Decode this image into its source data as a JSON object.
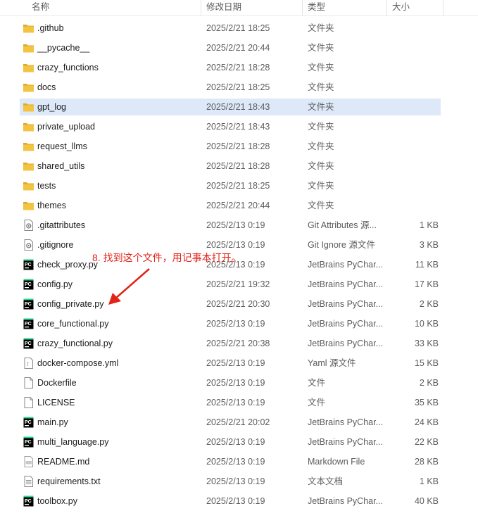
{
  "header": {
    "name": "名称",
    "date": "修改日期",
    "type": "类型",
    "size": "大小"
  },
  "files": [
    {
      "name": ".github",
      "date": "2025/2/21 18:25",
      "type": "文件夹",
      "size": "",
      "icon": "folder-icon"
    },
    {
      "name": "__pycache__",
      "date": "2025/2/21 20:44",
      "type": "文件夹",
      "size": "",
      "icon": "folder-icon"
    },
    {
      "name": "crazy_functions",
      "date": "2025/2/21 18:28",
      "type": "文件夹",
      "size": "",
      "icon": "folder-icon"
    },
    {
      "name": "docs",
      "date": "2025/2/21 18:25",
      "type": "文件夹",
      "size": "",
      "icon": "folder-icon"
    },
    {
      "name": "gpt_log",
      "date": "2025/2/21 18:43",
      "type": "文件夹",
      "size": "",
      "icon": "folder-icon",
      "selected": true
    },
    {
      "name": "private_upload",
      "date": "2025/2/21 18:43",
      "type": "文件夹",
      "size": "",
      "icon": "folder-icon"
    },
    {
      "name": "request_llms",
      "date": "2025/2/21 18:28",
      "type": "文件夹",
      "size": "",
      "icon": "folder-icon"
    },
    {
      "name": "shared_utils",
      "date": "2025/2/21 18:28",
      "type": "文件夹",
      "size": "",
      "icon": "folder-icon"
    },
    {
      "name": "tests",
      "date": "2025/2/21 18:25",
      "type": "文件夹",
      "size": "",
      "icon": "folder-icon"
    },
    {
      "name": "themes",
      "date": "2025/2/21 20:44",
      "type": "文件夹",
      "size": "",
      "icon": "folder-icon"
    },
    {
      "name": ".gitattributes",
      "date": "2025/2/13 0:19",
      "type": "Git Attributes 源...",
      "size": "1 KB",
      "icon": "git-file-icon"
    },
    {
      "name": ".gitignore",
      "date": "2025/2/13 0:19",
      "type": "Git Ignore 源文件",
      "size": "3 KB",
      "icon": "git-file-icon"
    },
    {
      "name": "check_proxy.py",
      "date": "2025/2/13 0:19",
      "type": "JetBrains PyChar...",
      "size": "11 KB",
      "icon": "pycharm-file-icon"
    },
    {
      "name": "config.py",
      "date": "2025/2/21 19:32",
      "type": "JetBrains PyChar...",
      "size": "17 KB",
      "icon": "pycharm-file-icon"
    },
    {
      "name": "config_private.py",
      "date": "2025/2/21 20:30",
      "type": "JetBrains PyChar...",
      "size": "2 KB",
      "icon": "pycharm-file-icon"
    },
    {
      "name": "core_functional.py",
      "date": "2025/2/13 0:19",
      "type": "JetBrains PyChar...",
      "size": "10 KB",
      "icon": "pycharm-file-icon"
    },
    {
      "name": "crazy_functional.py",
      "date": "2025/2/21 20:38",
      "type": "JetBrains PyChar...",
      "size": "33 KB",
      "icon": "pycharm-file-icon"
    },
    {
      "name": "docker-compose.yml",
      "date": "2025/2/13 0:19",
      "type": "Yaml 源文件",
      "size": "15 KB",
      "icon": "yaml-file-icon"
    },
    {
      "name": "Dockerfile",
      "date": "2025/2/13 0:19",
      "type": "文件",
      "size": "2 KB",
      "icon": "blank-file-icon"
    },
    {
      "name": "LICENSE",
      "date": "2025/2/13 0:19",
      "type": "文件",
      "size": "35 KB",
      "icon": "blank-file-icon"
    },
    {
      "name": "main.py",
      "date": "2025/2/21 20:02",
      "type": "JetBrains PyChar...",
      "size": "24 KB",
      "icon": "pycharm-file-icon"
    },
    {
      "name": "multi_language.py",
      "date": "2025/2/13 0:19",
      "type": "JetBrains PyChar...",
      "size": "22 KB",
      "icon": "pycharm-file-icon"
    },
    {
      "name": "README.md",
      "date": "2025/2/13 0:19",
      "type": "Markdown File",
      "size": "28 KB",
      "icon": "markdown-file-icon"
    },
    {
      "name": "requirements.txt",
      "date": "2025/2/13 0:19",
      "type": "文本文档",
      "size": "1 KB",
      "icon": "text-file-icon"
    },
    {
      "name": "toolbox.py",
      "date": "2025/2/13 0:19",
      "type": "JetBrains PyChar...",
      "size": "40 KB",
      "icon": "pycharm-file-icon"
    }
  ],
  "annotation": {
    "text": "8. 找到这个文件，用记事本打开。",
    "color": "#e2231a"
  },
  "colors": {
    "folder": "#f3c342",
    "selected_row": "#dde9f8",
    "pycharm_bg": "#000000",
    "pycharm_accent": "#21d789"
  }
}
